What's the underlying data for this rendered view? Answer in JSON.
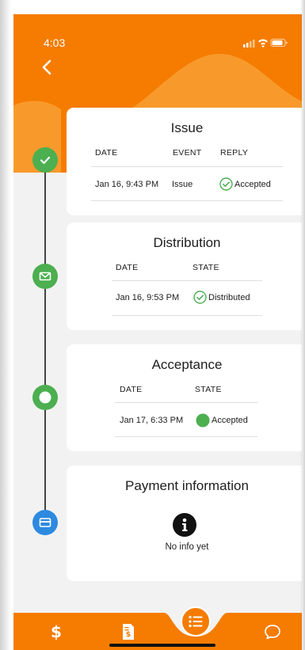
{
  "status_bar": {
    "time": "4:03"
  },
  "colors": {
    "orange": "#f57c00",
    "orange_light": "#f89a2b",
    "green": "#4caf50",
    "blue": "#2d8ae0"
  },
  "timeline": [
    {
      "icon": "check-icon"
    },
    {
      "icon": "envelope-icon"
    },
    {
      "icon": "circle-icon"
    },
    {
      "icon": "credit-card-icon"
    }
  ],
  "cards": {
    "issue": {
      "title": "Issue",
      "headers": {
        "date": "DATE",
        "event": "EVENT",
        "reply": "REPLY"
      },
      "row": {
        "date": "Jan 16, 9:43 PM",
        "event": "Issue",
        "reply": "Accepted"
      }
    },
    "distribution": {
      "title": "Distribution",
      "headers": {
        "date": "DATE",
        "state": "STATE"
      },
      "row": {
        "date": "Jan 16, 9:53 PM",
        "state": "Distributed"
      }
    },
    "acceptance": {
      "title": "Acceptance",
      "headers": {
        "date": "DATE",
        "state": "STATE"
      },
      "row": {
        "date": "Jan 17, 6:33 PM",
        "state": "Accepted"
      }
    },
    "payment": {
      "title": "Payment information",
      "message": "No info yet"
    }
  },
  "tabbar": {
    "tabs": [
      {
        "icon": "dollar-icon"
      },
      {
        "icon": "invoice-icon"
      },
      {
        "icon": "list-icon",
        "active": true
      },
      {
        "icon": "chat-icon"
      }
    ]
  }
}
